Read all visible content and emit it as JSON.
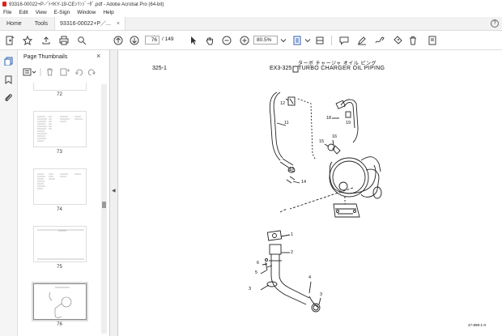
{
  "window": {
    "title": "93316-00022+P／ﾄｲKY-19-CEｼﾘﾝｼﾞｰﾀﾞ.pdf - Adobe Acrobat Pro (64-bit)"
  },
  "menu": [
    "File",
    "Edit",
    "View",
    "E-Sign",
    "Window",
    "Help"
  ],
  "tabs": {
    "home": "Home",
    "tools": "Tools",
    "doc": "93316-00022+P／...",
    "doc_close": "×",
    "help": "?"
  },
  "toolbar": {
    "page_current": "76",
    "page_total": "/ 149",
    "zoom": "80.5%"
  },
  "thumbnails": {
    "title": "Page Thumbnails",
    "close": "×",
    "items": [
      {
        "label": "72"
      },
      {
        "label": "73"
      },
      {
        "label": "74"
      },
      {
        "label": "75"
      },
      {
        "label": "76",
        "selected": true
      }
    ]
  },
  "collapse_arrow": "◀",
  "document": {
    "page_code": "325-1",
    "title_jp": "ターボ チャージャ オイル ピング",
    "title_code": "EX3-325",
    "title_en": "TURBO CHARGER OIL PIPING",
    "callouts": [
      "12",
      "11",
      "18",
      "19",
      "16",
      "15",
      "13",
      "14",
      "1",
      "2",
      "6",
      "5",
      "3",
      "4",
      "3"
    ],
    "footer": "47-899-1-0"
  }
}
